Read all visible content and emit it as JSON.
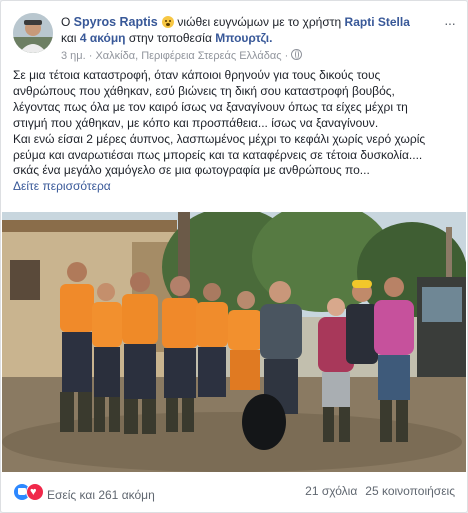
{
  "post": {
    "author": "Spyros Raptis",
    "feeling_text": "νιώθει ευγνώμων με το χρήστη",
    "tagged_user": "Rapti Stella",
    "and_word": "και",
    "others_link": "4 ακόμη",
    "location_prefix": "στην τοποθεσία",
    "location": "Μπουρτζι.",
    "time": "3 ημ.",
    "place": "Χαλκίδα, Περιφέρεια Στερεάς Ελλάδας",
    "separator": " · ",
    "more_icon_label": "···",
    "feeling_icon": "grinning-face-emoji",
    "privacy_icon": "globe-icon"
  },
  "body": {
    "lines": [
      "Σε μια τέτοια καταστροφή, όταν κάποιοι θρηνούν για τους δικούς τους",
      "ανθρώπους που χάθηκαν, εσύ βιώνεις τη δική σου καταστροφή βουβός,",
      "λέγοντας πως όλα με τον καιρό ίσως να ξαναγίνουν όπως τα είχες μέχρι τη",
      "στιγμή που χάθηκαν, με κόπο και προσπάθεια... ίσως να ξαναγίνουν.",
      "Και ενώ είσαι 2 μέρες άυπνος, λασπωμένος μέχρι το κεφάλι χωρίς νερό χωρίς",
      "ρεύμα και αναρωτιέσαι πως μπορείς και τα καταφέρνεις σε τέτοια δυσκολία....",
      "σκάς ένα μεγάλο χαμόγελο σε μια φωτογραφία με ανθρώπους πο..."
    ],
    "see_more": "Δείτε περισσότερα"
  },
  "footer": {
    "reactions_text": "Εσείς και 261 ακόμη",
    "comments": "21 σχόλια",
    "shares": "25 κοινοποιήσεις",
    "reaction_icons": [
      "like-icon",
      "love-icon"
    ]
  },
  "colors": {
    "link": "#385898",
    "meta": "#90949c",
    "like": "#2d88ff",
    "love": "#f0284a"
  }
}
